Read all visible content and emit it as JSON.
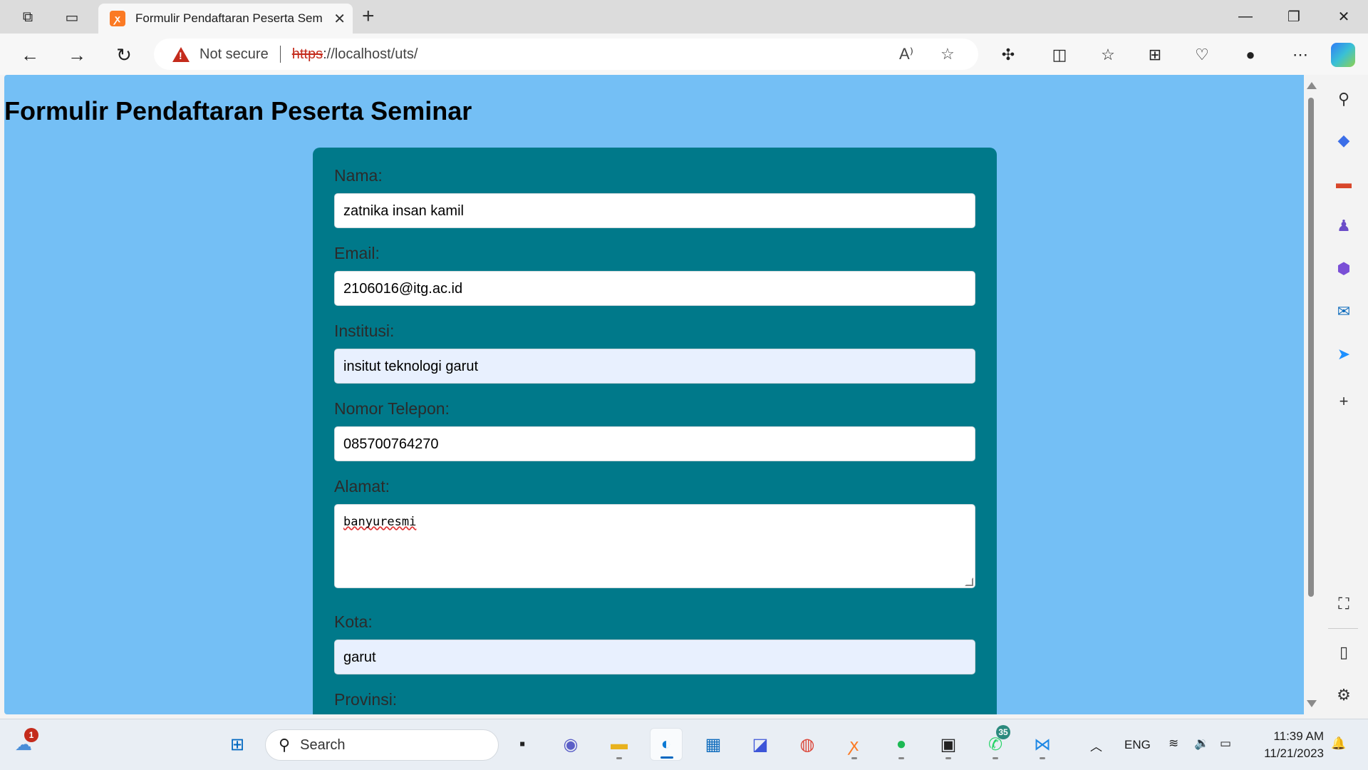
{
  "browser": {
    "tab_title": "Formulir Pendaftaran Peserta Seminar",
    "tab_favicon": "xampp-icon",
    "security_label": "Not secure",
    "url_protocol": "https",
    "url_rest": "://localhost/uts/"
  },
  "page": {
    "title": "Formulir Pendaftaran Peserta Seminar",
    "background_color": "#74bff5",
    "card_color": "#00798a"
  },
  "form": {
    "nama_label": "Nama:",
    "nama_value": "zatnika insan kamil",
    "email_label": "Email:",
    "email_value": "2106016@itg.ac.id",
    "institusi_label": "Institusi:",
    "institusi_value": "insitut teknologi garut",
    "telepon_label": "Nomor Telepon:",
    "telepon_value": "085700764270",
    "alamat_label": "Alamat:",
    "alamat_value": "banyuresmi",
    "kota_label": "Kota:",
    "kota_value": "garut",
    "provinsi_label": "Provinsi:"
  },
  "taskbar": {
    "search_label": "Search",
    "weather_badge": "1",
    "whatsapp_badge": "35",
    "language": "ENG",
    "time": "11:39 AM",
    "date": "11/21/2023"
  }
}
